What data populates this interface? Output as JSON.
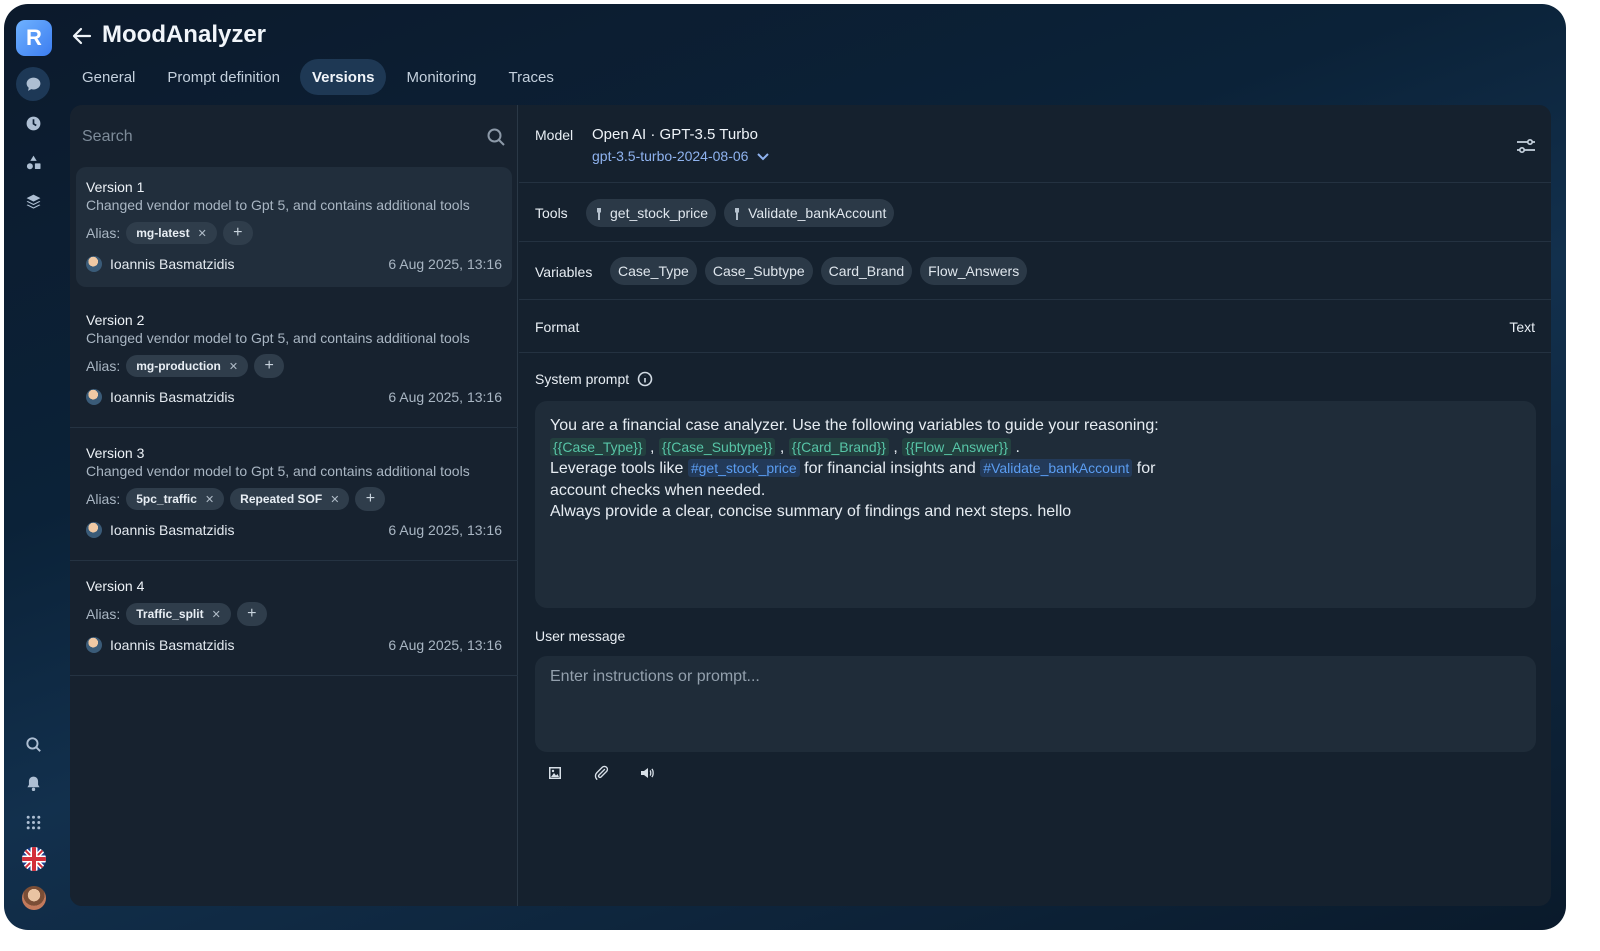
{
  "app": {
    "logo_letter": "R",
    "title": "MoodAnalyzer"
  },
  "tabs": [
    {
      "label": "General"
    },
    {
      "label": "Prompt definition"
    },
    {
      "label": "Versions",
      "active": true
    },
    {
      "label": "Monitoring"
    },
    {
      "label": "Traces"
    }
  ],
  "search": {
    "placeholder": "Search"
  },
  "versions": [
    {
      "title": "Version 1",
      "desc": "Changed vendor model to Gpt 5, and contains additional tools",
      "alias_label": "Alias:",
      "aliases": [
        "mg-latest"
      ],
      "author": "Ioannis Basmatzidis",
      "date": "6 Aug 2025, 13:16"
    },
    {
      "title": "Version 2",
      "desc": "Changed vendor model to Gpt 5, and contains additional tools",
      "alias_label": "Alias:",
      "aliases": [
        "mg-production"
      ],
      "author": "Ioannis Basmatzidis",
      "date": "6 Aug 2025, 13:16"
    },
    {
      "title": "Version 3",
      "desc": "Changed vendor model to Gpt 5, and contains additional tools",
      "alias_label": "Alias:",
      "aliases": [
        "5pc_traffic",
        "Repeated SOF"
      ],
      "author": "Ioannis Basmatzidis",
      "date": "6 Aug 2025, 13:16"
    },
    {
      "title": "Version 4",
      "desc": "",
      "alias_label": "Alias:",
      "aliases": [
        "Traffic_split"
      ],
      "author": "Ioannis Basmatzidis",
      "date": "6 Aug 2025, 13:16"
    }
  ],
  "config": {
    "model_label": "Model",
    "model_name": "Open AI · GPT-3.5 Turbo",
    "model_version": "gpt-3.5-turbo-2024-08-06",
    "tools_label": "Tools",
    "tools": [
      "get_stock_price",
      "Validate_bankAccount"
    ],
    "variables_label": "Variables",
    "variables": [
      "Case_Type",
      "Case_Subtype",
      "Card_Brand",
      "Flow_Answers"
    ],
    "format_label": "Format",
    "format_value": "Text",
    "system_prompt_label": "System prompt",
    "system_prompt": {
      "line1": "You are a financial case analyzer. Use the following variables to guide your reasoning:",
      "vars": [
        "{{Case_Type}}",
        "{{Case_Subtype}}",
        "{{Card_Brand}}",
        "{{Flow_Answer}}"
      ],
      "line3_a": "Leverage tools like ",
      "ref1": "#get_stock_price",
      "line3_b": " for financial insights and ",
      "ref2": "#Validate_bankAccount",
      "line3_c": " for",
      "line4": "account checks when needed.",
      "line5": "Always provide a clear, concise summary of findings and next steps. hello"
    },
    "user_message_label": "User message",
    "user_message_placeholder": "Enter instructions or prompt..."
  },
  "colors": {
    "accent": "#5b9df1",
    "variable": "#57c5a7",
    "panel": "#15212e"
  }
}
